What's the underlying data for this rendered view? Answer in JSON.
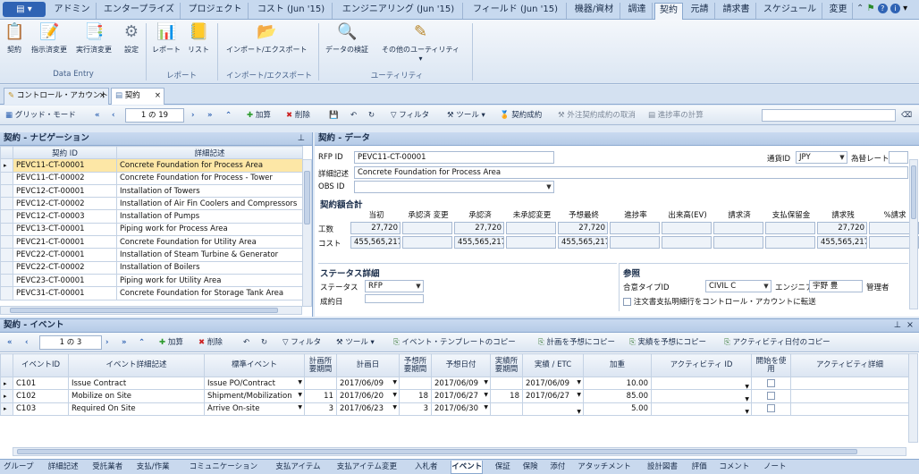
{
  "app_menu_icon": "menu-icon",
  "ribbon_tabs": [
    {
      "label": "アドミン"
    },
    {
      "label": "エンタープライズ"
    },
    {
      "label": "プロジェクト"
    },
    {
      "label": "コスト (Jun '15)"
    },
    {
      "label": "エンジニアリング (Jun '15)"
    },
    {
      "label": "フィールド (Jun '15)"
    },
    {
      "label": "機器/資材"
    },
    {
      "label": "調達"
    },
    {
      "label": "契約"
    },
    {
      "label": "元請"
    },
    {
      "label": "請求書"
    },
    {
      "label": "スケジュール"
    },
    {
      "label": "変更"
    }
  ],
  "ribbon": {
    "items": [
      {
        "label": "契約",
        "icon": "contract-icon"
      },
      {
        "label": "指示済変更",
        "icon": "directed-change-icon"
      },
      {
        "label": "実行済変更",
        "icon": "executed-change-icon"
      },
      {
        "label": "設定",
        "icon": "settings-icon"
      },
      {
        "label": "レポート",
        "icon": "report-icon"
      },
      {
        "label": "リスト",
        "icon": "list-icon"
      },
      {
        "label": "インポート/エクスポート",
        "icon": "import-export-icon"
      },
      {
        "label": "データの検証",
        "icon": "data-validation-icon"
      },
      {
        "label": "その他のユーティリティ",
        "icon": "utilities-icon"
      }
    ],
    "groups": [
      {
        "label": "Data Entry"
      },
      {
        "label": "レポート"
      },
      {
        "label": "インポート/エクスポート"
      },
      {
        "label": "ユーティリティ"
      }
    ]
  },
  "doc_tabs": [
    {
      "label": "コントロール・アカウント"
    },
    {
      "label": "契約"
    }
  ],
  "toolbar": {
    "grid_mode": "グリッド・モード",
    "page": "1 の 19",
    "add": "加算",
    "delete": "削除",
    "filter": "フィルタ",
    "tools": "ツール",
    "contract_award": "契約成約",
    "cancel_award": "外注契約成約の取消",
    "calc_progress": "進捗率の計算"
  },
  "nav": {
    "title": "契約 - ナビゲーション",
    "columns": [
      "契約 ID",
      "詳細記述"
    ],
    "rows": [
      {
        "id": "PEVC11-CT-00001",
        "desc": "Concrete Foundation for Process Area"
      },
      {
        "id": "PEVC11-CT-00002",
        "desc": "Concrete Foundation for Process - Tower"
      },
      {
        "id": "PEVC12-CT-00001",
        "desc": "Installation of Towers"
      },
      {
        "id": "PEVC12-CT-00002",
        "desc": "Installation of Air Fin Coolers and Compressors"
      },
      {
        "id": "PEVC12-CT-00003",
        "desc": "Installation of Pumps"
      },
      {
        "id": "PEVC13-CT-00001",
        "desc": "Piping work for Process Area"
      },
      {
        "id": "PEVC21-CT-00001",
        "desc": "Concrete Foundation for Utility Area"
      },
      {
        "id": "PEVC22-CT-00001",
        "desc": "Installation of Steam Turbine & Generator"
      },
      {
        "id": "PEVC22-CT-00002",
        "desc": "Installation of Boilers"
      },
      {
        "id": "PEVC23-CT-00001",
        "desc": "Piping work for Utility Area"
      },
      {
        "id": "PEVC31-CT-00001",
        "desc": "Concrete Foundation for Storage Tank Area"
      }
    ]
  },
  "data": {
    "title": "契約 - データ",
    "rfp_label": "RFP ID",
    "rfp_value": "PEVC11-CT-00001",
    "desc_label": "詳細記述",
    "desc_value": "Concrete Foundation for Process Area",
    "obs_label": "OBS ID",
    "obs_value": "",
    "currency_label": "通貨ID",
    "currency_value": "JPY",
    "fx_label": "為替レート",
    "fx_value": "",
    "totals_title": "契約額合計",
    "totals_cols": [
      "当初",
      "承認済 変更",
      "承認済",
      "未承認変更",
      "予想最終",
      "進捗率",
      "出来高(EV)",
      "請求済",
      "支払保留金",
      "請求残",
      "%請求"
    ],
    "rows": [
      {
        "label": "工数",
        "values": [
          "27,720",
          "",
          "27,720",
          "",
          "27,720",
          "",
          "",
          "",
          "",
          "27,720",
          ""
        ]
      },
      {
        "label": "コスト",
        "values": [
          "455,565,217",
          "",
          "455,565,217",
          "",
          "455,565,217",
          "",
          "",
          "",
          "",
          "455,565,217",
          ""
        ]
      }
    ],
    "status_title": "ステータス詳細",
    "status_label": "ステータス",
    "status_value": "RFP",
    "award_date_label": "成約日",
    "ref_title": "参照",
    "agreement_label": "合意タイプID",
    "agreement_value": "CIVIL C",
    "engineer_label": "エンジニア",
    "engineer_value": "宇野 豊",
    "manager_label": "管理者",
    "transfer_label": "注文書支払明細行をコントロール・アカウントに転送"
  },
  "events": {
    "title": "契約 - イベント",
    "page": "1 の 3",
    "add": "加算",
    "delete": "削除",
    "filter": "フィルタ",
    "tools": "ツール",
    "copy_template": "イベント・テンプレートのコピー",
    "copy_plan": "計画を予想にコピー",
    "copy_actual": "実績を予想にコピー",
    "copy_activity": "アクティビティ日付のコピー",
    "columns": [
      "イベントID",
      "イベント詳細記述",
      "標準イベント",
      "計画所要期間",
      "計画日",
      "予想所要期間",
      "予想日付",
      "実績所要期間",
      "実績 / ETC",
      "加重",
      "アクティビティ ID",
      "開始を使用",
      "アクティビティ詳細"
    ],
    "rows": [
      {
        "id": "C101",
        "desc": "Issue Contract",
        "std": "Issue PO/Contract",
        "pdur": "",
        "pdate": "2017/06/09",
        "fdur": "",
        "fdate": "2017/06/09",
        "adur": "",
        "adate": "2017/06/09",
        "weight": "10.00"
      },
      {
        "id": "C102",
        "desc": "Mobilize on Site",
        "std": "Shipment/Mobilization",
        "pdur": "11",
        "pdate": "2017/06/20",
        "fdur": "18",
        "fdate": "2017/06/27",
        "adur": "18",
        "adate": "2017/06/27",
        "weight": "85.00"
      },
      {
        "id": "C103",
        "desc": "Required On Site",
        "std": "Arrive On-site",
        "pdur": "3",
        "pdate": "2017/06/23",
        "fdur": "3",
        "fdate": "2017/06/30",
        "adur": "",
        "adate": "",
        "weight": "5.00"
      }
    ]
  },
  "bottom_tabs": [
    {
      "label": "グループ"
    },
    {
      "label": "詳細記述"
    },
    {
      "label": "受託業者"
    },
    {
      "label": "支払/作業"
    },
    {
      "label": "コミュニケーション"
    },
    {
      "label": "支払アイテム"
    },
    {
      "label": "支払アイテム変更"
    },
    {
      "label": "入札者"
    },
    {
      "label": "イベント"
    },
    {
      "label": "保証"
    },
    {
      "label": "保険"
    },
    {
      "label": "添付"
    },
    {
      "label": "アタッチメント"
    },
    {
      "label": "設計図書"
    },
    {
      "label": "評価"
    },
    {
      "label": "コメント"
    },
    {
      "label": "ノート"
    }
  ],
  "colors": {
    "accent": "#2f63b4",
    "selected_row": "#fde7a6",
    "panel_header": "#b6cbe7"
  }
}
